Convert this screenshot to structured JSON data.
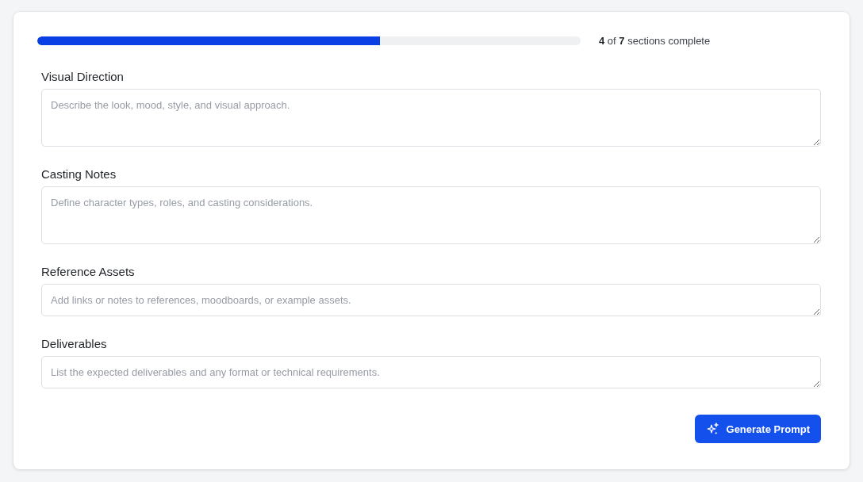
{
  "progress": {
    "level": 0.63,
    "summary": "**4** of **7** sections complete"
  },
  "fields": [
    {
      "label": "Visual Direction",
      "placeholder": "Describe the look, mood, style, and visual approach.",
      "kind": "multiline"
    },
    {
      "label": "Casting Notes",
      "placeholder": "Define character types, roles, and casting considerations.",
      "kind": "multiline"
    },
    {
      "label": "Reference Assets",
      "placeholder": "Add links or notes to references, moodboards, or example assets.",
      "kind": "singleline"
    },
    {
      "label": "Deliverables",
      "placeholder": "List the expected deliverables and any format or technical requirements.",
      "kind": "singleline"
    }
  ],
  "generate_button": {
    "label": "Generate Prompt"
  }
}
